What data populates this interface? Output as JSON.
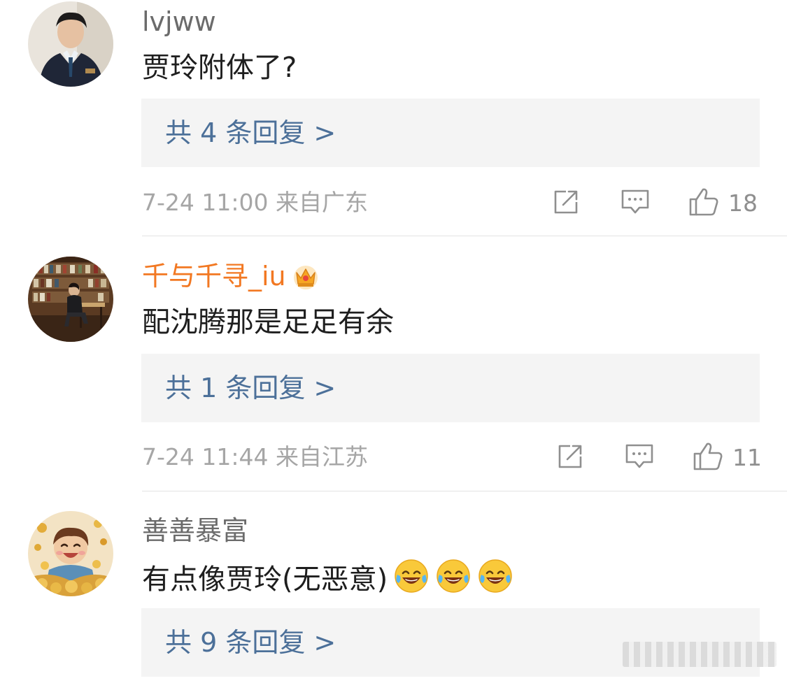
{
  "comments": [
    {
      "username": "lvjww",
      "text": "贾玲附体了?",
      "reply_link": "共 4 条回复 >",
      "meta": "7-24 11:00  来自广东",
      "likes": "18",
      "avatar": "man-in-suit-avatar"
    },
    {
      "username": "千与千寻_iu",
      "text": "配沈腾那是足足有余",
      "reply_link": "共 1 条回复 >",
      "meta": "7-24 11:44  来自江苏",
      "likes": "11",
      "avatar": "library-reading-avatar",
      "badge": "crown-icon"
    },
    {
      "username": "善善暴富",
      "text": "有点像贾玲(无恶意)",
      "reply_link": "共 9 条回复 >",
      "avatar": "cartoon-boy-coins-avatar",
      "emojis": [
        "laugh-cry-emoji",
        "laugh-cry-emoji",
        "laugh-cry-emoji"
      ]
    }
  ],
  "colors": {
    "vip_name": "#f27822",
    "reply_link": "#4c7099",
    "reply_bg": "#f4f4f4",
    "meta": "#a6a6a6"
  },
  "icons": [
    "share-icon",
    "comment-icon",
    "like-icon"
  ]
}
